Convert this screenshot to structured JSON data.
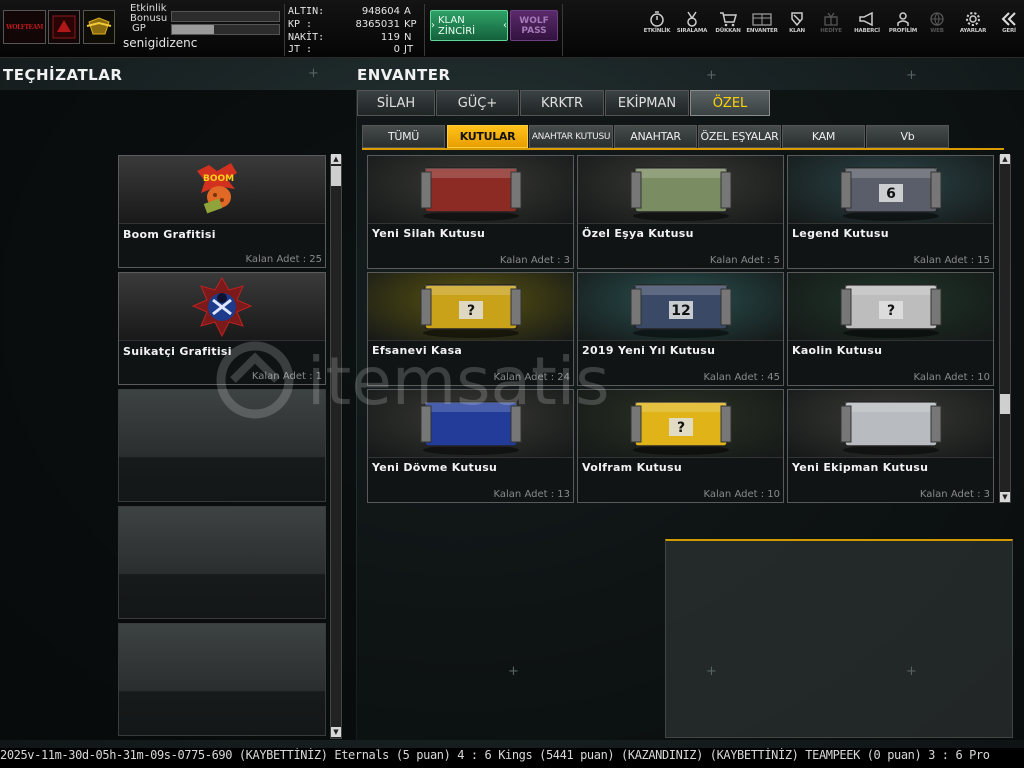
{
  "header": {
    "logo_text": "WOLFTEAM",
    "etkinlik_label": "Etkinlik\nBonusu",
    "gp_label": "GP",
    "username": "senigidizenc",
    "etkinlik_fill": 0,
    "gp_fill": 0.39,
    "currencies": [
      {
        "label": "ALTIN:",
        "value": "948604",
        "unit": "A"
      },
      {
        "label": "KP :",
        "value": "8365031",
        "unit": "KP"
      },
      {
        "label": "NAKİT:",
        "value": "119",
        "unit": "N"
      },
      {
        "label": "JT :",
        "value": "0",
        "unit": "JT"
      }
    ],
    "klan_zinciri": "KLAN ZİNCİRİ",
    "wolf_pass": "WOLF\nPASS",
    "nav": [
      {
        "label": "ETKİNLİK",
        "icon": "stopwatch-icon"
      },
      {
        "label": "SIRALAMA",
        "icon": "medal-icon"
      },
      {
        "label": "DÜKKAN",
        "icon": "cart-icon"
      },
      {
        "label": "ENVANTER",
        "icon": "inventory-icon"
      },
      {
        "label": "KLAN",
        "icon": "shield-icon"
      },
      {
        "label": "HEDİYE",
        "icon": "gift-icon",
        "dim": true
      },
      {
        "label": "HABERCİ",
        "icon": "megaphone-icon"
      },
      {
        "label": "PROFİLİM",
        "icon": "profile-icon"
      },
      {
        "label": "WEB",
        "icon": "globe-icon",
        "dim": true
      },
      {
        "label": "AYARLAR",
        "icon": "gear-icon"
      },
      {
        "label": "GERİ",
        "icon": "back-icon"
      }
    ]
  },
  "left": {
    "title": "TEÇHİZATLAR",
    "items": [
      {
        "name": "Boom Grafitisi",
        "count": "Kalan Adet : 25"
      },
      {
        "name": "Suikatçi Grafitisi",
        "count": "Kalan Adet : 1"
      }
    ]
  },
  "right": {
    "title": "ENVANTER",
    "tabs": [
      "SİLAH",
      "GÜÇ+",
      "KRKTR",
      "EKİPMAN",
      "ÖZEL"
    ],
    "subtabs": [
      "TÜMÜ",
      "KUTULAR",
      "ANAHTAR KUTUSU",
      "ANAHTAR",
      "ÖZEL EŞYALAR",
      "KAM",
      "Vb"
    ],
    "items": [
      {
        "name": "Yeni Silah Kutusu",
        "count": "Kalan Adet : 3",
        "color": "#8c2a24",
        "bg": "#3a3a36"
      },
      {
        "name": "Özel Eşya Kutusu",
        "count": "Kalan Adet : 5",
        "color": "#7a8c62",
        "bg": "#3a3a36"
      },
      {
        "name": "Legend Kutusu",
        "count": "Kalan Adet : 15",
        "color": "#5a5e6a",
        "bg": "#2b4548",
        "label": "6"
      },
      {
        "name": "Efsanevi Kasa",
        "count": "Kalan Adet : 24",
        "color": "#c9a21a",
        "bg": "#5a5410",
        "label": "?"
      },
      {
        "name": "2019 Yeni Yıl Kutusu",
        "count": "Kalan Adet : 45",
        "color": "#3a4a66",
        "bg": "#2a5050",
        "label": "12"
      },
      {
        "name": "Kaolin Kutusu",
        "count": "Kalan Adet : 10",
        "color": "#bdbdbd",
        "bg": "#1f3528",
        "label": "?"
      },
      {
        "name": "Yeni Dövme Kutusu",
        "count": "Kalan Adet : 13",
        "color": "#233c9a",
        "bg": "#3a3a36"
      },
      {
        "name": "Volfram Kutusu",
        "count": "Kalan Adet : 10",
        "color": "#e0b419",
        "bg": "#2a3324",
        "label": "?"
      },
      {
        "name": "Yeni Ekipman Kutusu",
        "count": "Kalan Adet : 3",
        "color": "#b8bcc0",
        "bg": "#3a3a36"
      }
    ]
  },
  "watermark": "itemsatis",
  "ticker": "2025v-11m-30d-05h-31m-09s-0775-690    (KAYBETTİNİZ) Eternals (5 puan) 4 : 6 Kings (5441 puan) (KAZANDINIZ)              (KAYBETTİNİZ) TEAMPEEK (0 puan) 3 : 6 Pro"
}
